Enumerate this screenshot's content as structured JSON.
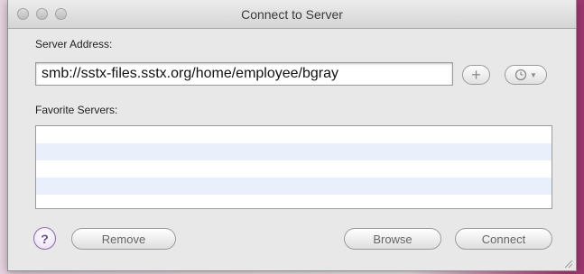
{
  "window": {
    "title": "Connect to Server"
  },
  "server_address": {
    "label": "Server Address:",
    "value": "smb://sstx-files.sstx.org/home/employee/bgray"
  },
  "add_button": {
    "icon": "plus-icon"
  },
  "recent_button": {
    "icon": "clock-icon"
  },
  "favorites": {
    "label": "Favorite Servers:",
    "items": []
  },
  "buttons": {
    "help": "?",
    "remove": "Remove",
    "browse": "Browse",
    "connect": "Connect"
  },
  "colors": {
    "row_alt": "#eaf0fb",
    "help_accent": "#8c6aa8"
  }
}
